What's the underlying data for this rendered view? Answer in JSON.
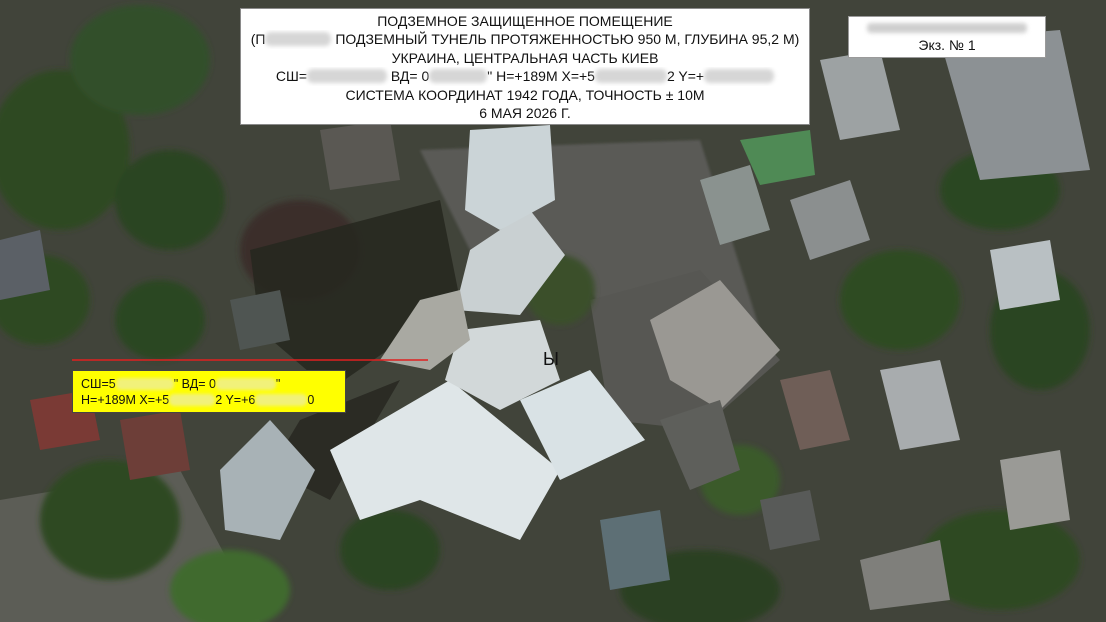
{
  "title_box": {
    "line1": "ПОДЗЕМНОЕ ЗАЩИЩЕННОЕ ПОМЕЩЕНИЕ",
    "line2_prefix": "(П",
    "line2_rest": " ПОДЗЕМНЫЙ ТУНЕЛЬ ПРОТЯЖЕННОСТЬЮ 950 М, ГЛУБИНА 95,2 М)",
    "line3": "УКРАИНА, ЦЕНТРАЛЬНАЯ ЧАСТЬ КИЕВ",
    "line4_a": "СШ=",
    "line4_b": " ВД= 0",
    "line4_c": "\" H=+189M X=+5",
    "line4_d": "2 Y=+",
    "line5": "СИСТЕМА КООРДИНАТ 1942 ГОДА, ТОЧНОСТЬ ± 10М",
    "line6": "6 МАЯ 2026 Г."
  },
  "copy_box": {
    "label": "Экз. № 1"
  },
  "coord_box": {
    "line1_a": "СШ=5",
    "line1_b": "\" ВД= 0",
    "line1_c": "\"",
    "line2_a": "H=+189M X=+5",
    "line2_b": "2 Y=+6",
    "line2_c": "0"
  },
  "map_label": "Ы",
  "colors": {
    "marker_line": "#e02020",
    "coord_box_bg": "#ffff00",
    "title_bg": "#ffffff"
  }
}
